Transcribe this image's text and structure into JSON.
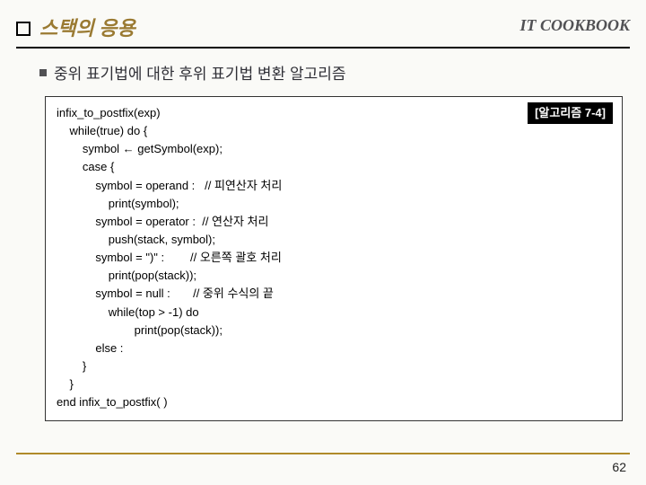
{
  "header": {
    "title": "스택의 응용",
    "brand": "IT COOKBOOK"
  },
  "subheading": "중위 표기법에 대한 후위 표기법 변환 알고리즘",
  "algo_badge": "[알고리즘 7-4]",
  "code": {
    "l00": "infix_to_postfix(exp)",
    "l01": "    while(true) do {",
    "l02": "        symbol ← getSymbol(exp);",
    "l03": "        case {",
    "l04": "            symbol = operand :   // 피연산자 처리",
    "l05": "                print(symbol);",
    "l06": "            symbol = operator :  // 연산자 처리",
    "l07": "                push(stack, symbol);",
    "l08": "            symbol = \")\" :        // 오른쪽 괄호 처리",
    "l09": "                print(pop(stack));",
    "l10": "            symbol = null :       // 중위 수식의 끝",
    "l11": "                while(top > -1) do",
    "l12": "                        print(pop(stack));",
    "l13": "            else :",
    "l14": "        }",
    "l15": "    }",
    "l16": "end infix_to_postfix( )"
  },
  "page_number": "62"
}
